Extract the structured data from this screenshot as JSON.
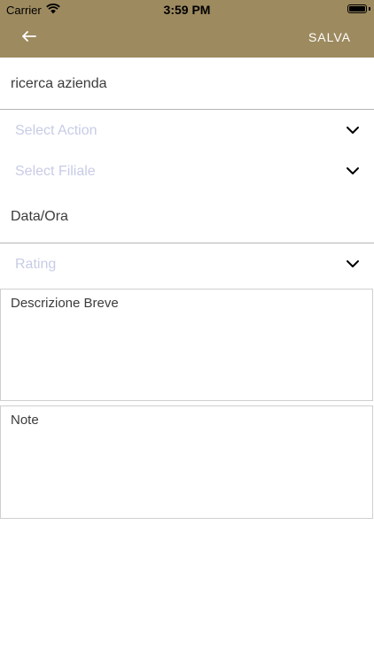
{
  "status": {
    "carrier": "Carrier",
    "time": "3:59 PM"
  },
  "header": {
    "save_label": "SALVA",
    "back_icon": "arrow-left-icon"
  },
  "form": {
    "company_search": "ricerca azienda",
    "select_action": "Select Action",
    "select_branch": "Select Filiale",
    "datetime": "Data/Ora",
    "rating": "Rating",
    "short_description": "Descrizione Breve",
    "notes": "Note"
  },
  "colors": {
    "header_bg": "#9d8a5f",
    "placeholder": "#c7cce6"
  }
}
